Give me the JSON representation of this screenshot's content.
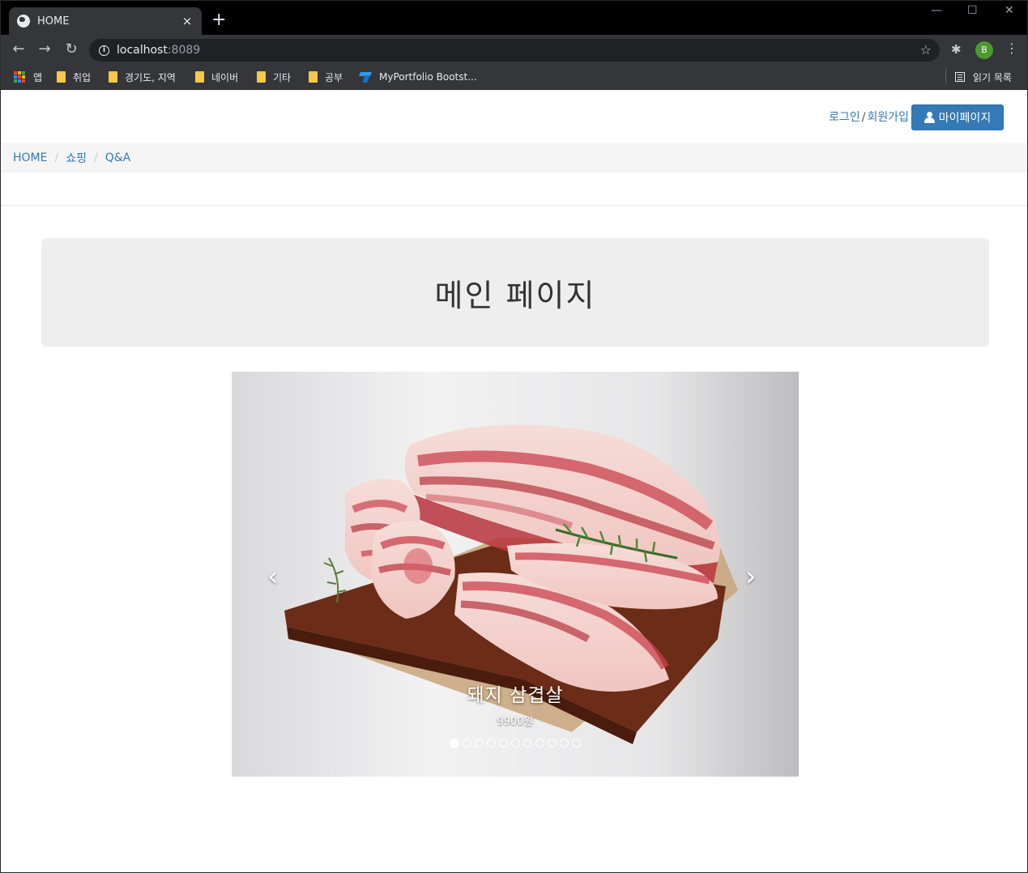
{
  "browser": {
    "tab_title": "HOME",
    "tab_close": "×",
    "new_tab": "+",
    "window_controls": {
      "minimize": "—",
      "maximize": "☐",
      "close": "✕"
    },
    "url_host": "localhost",
    "url_port": ":8089",
    "profile_initial": "B",
    "bookmarks": [
      {
        "label": "앱",
        "type": "apps"
      },
      {
        "label": "취업",
        "type": "folder"
      },
      {
        "label": "경기도, 지역",
        "type": "folder"
      },
      {
        "label": "네이버",
        "type": "folder"
      },
      {
        "label": "기타",
        "type": "folder"
      },
      {
        "label": "공부",
        "type": "folder"
      },
      {
        "label": "MyPortfolio Bootst...",
        "type": "site"
      }
    ],
    "reading_list": "읽기 목록"
  },
  "header": {
    "login": "로그인",
    "separator": "/",
    "signup": "회원가입",
    "mypage_label": "마이페이지"
  },
  "breadcrumb": {
    "items": [
      "HOME",
      "쇼핑",
      "Q&A"
    ],
    "separator": "/"
  },
  "jumbotron": {
    "title": "메인 페이지"
  },
  "carousel": {
    "prev": "‹",
    "next": "›",
    "caption_title": "돼지 삼겹살",
    "caption_price": "9900원",
    "slide_count": 11,
    "active_index": 0
  }
}
